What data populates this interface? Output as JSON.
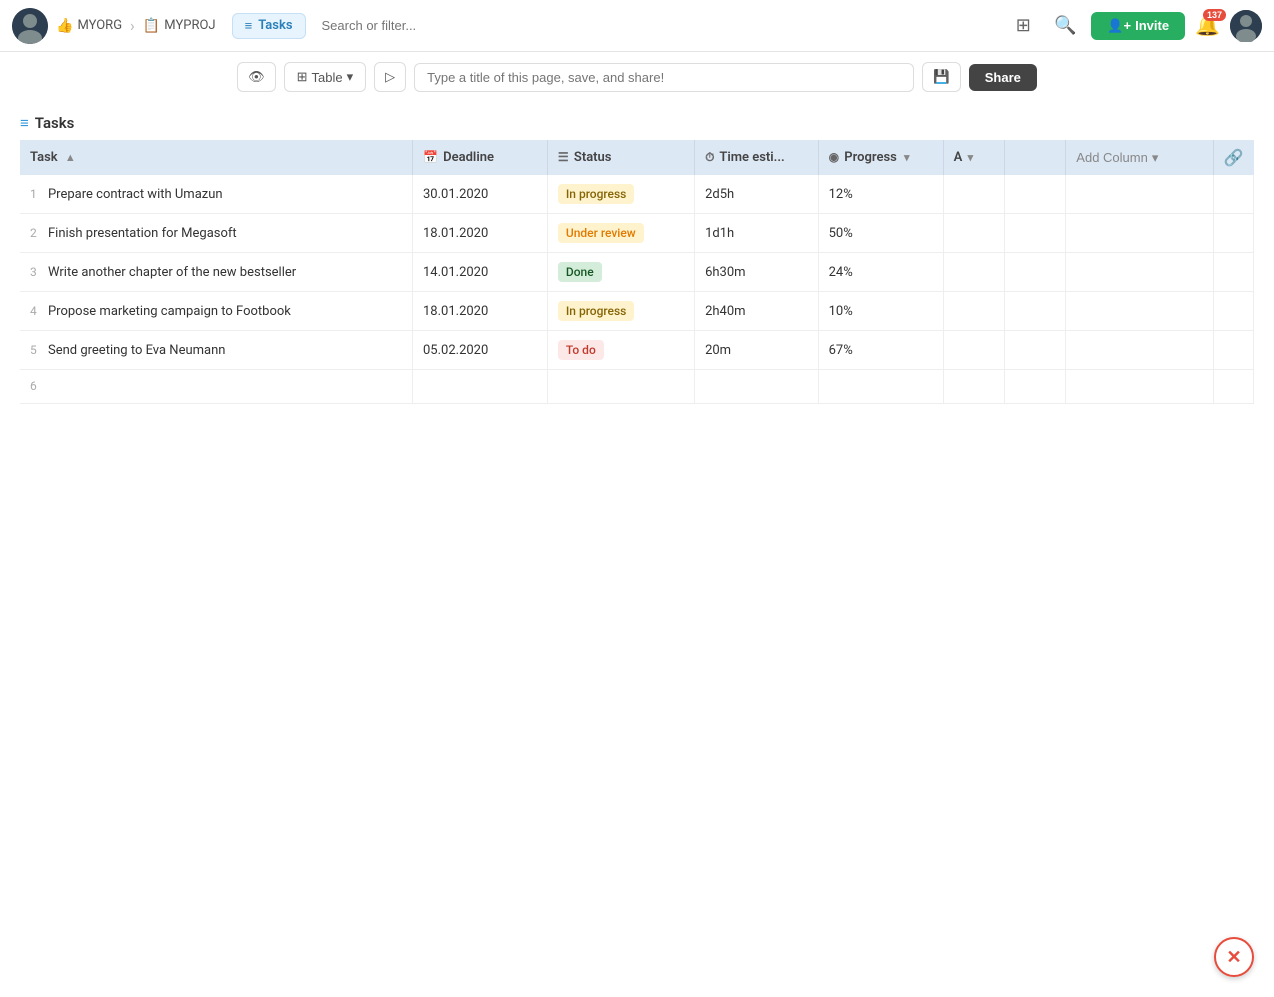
{
  "navbar": {
    "org_label": "MYORG",
    "proj_label": "MYPROJ",
    "tasks_label": "Tasks",
    "search_placeholder": "Search or filter...",
    "invite_label": "Invite",
    "notification_count": "137"
  },
  "toolbar": {
    "view_icon": "👁",
    "table_label": "Table",
    "export_icon": "▷",
    "page_title_placeholder": "Type a title of this page, save, and share!",
    "share_label": "Share"
  },
  "section": {
    "title": "Tasks"
  },
  "table": {
    "columns": [
      "Task",
      "Deadline",
      "Status",
      "Time esti...",
      "Progress",
      "A",
      "",
      "Add Column"
    ],
    "rows": [
      {
        "num": "1",
        "task": "Prepare contract with Umazun",
        "deadline": "30.01.2020",
        "status": "In progress",
        "status_type": "inprogress",
        "time": "2d5h",
        "progress": "12%"
      },
      {
        "num": "2",
        "task": "Finish presentation for Megasoft",
        "deadline": "18.01.2020",
        "status": "Under review",
        "status_type": "underreview",
        "time": "1d1h",
        "progress": "50%"
      },
      {
        "num": "3",
        "task": "Write another chapter of the new bestseller",
        "deadline": "14.01.2020",
        "status": "Done",
        "status_type": "done",
        "time": "6h30m",
        "progress": "24%"
      },
      {
        "num": "4",
        "task": "Propose marketing campaign to Footbook",
        "deadline": "18.01.2020",
        "status": "In progress",
        "status_type": "inprogress",
        "time": "2h40m",
        "progress": "10%"
      },
      {
        "num": "5",
        "task": "Send greeting to Eva Neumann",
        "deadline": "05.02.2020",
        "status": "To do",
        "status_type": "todo",
        "time": "20m",
        "progress": "67%"
      }
    ]
  }
}
